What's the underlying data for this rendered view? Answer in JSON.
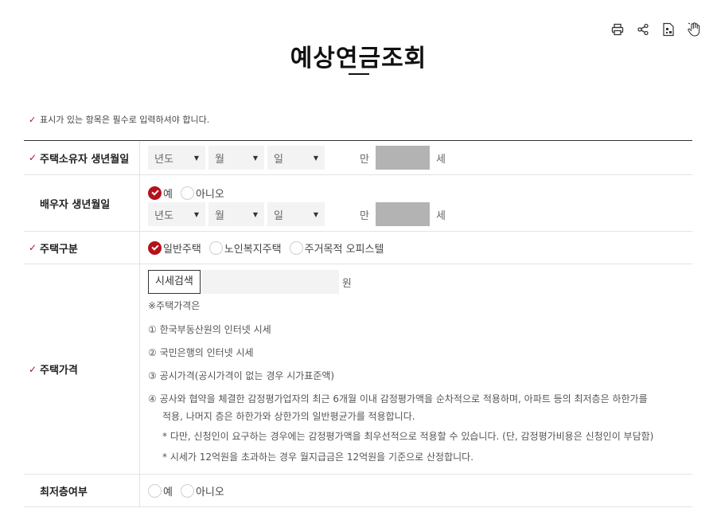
{
  "toolbar": {
    "icons": [
      "print-icon",
      "share-icon",
      "qr-document-icon",
      "hand-touch-icon"
    ]
  },
  "page": {
    "title": "예상연금조회",
    "notice": "표시가 있는 항목은 필수로 입력하셔야 합니다."
  },
  "form": {
    "owner_birth": {
      "label": "주택소유자 생년월일",
      "year": "년도",
      "month": "월",
      "day": "일",
      "age_prefix": "만",
      "age_unit": "세"
    },
    "spouse_birth": {
      "label": "배우자 생년월일",
      "yes": "예",
      "no": "아니오",
      "selected": "예",
      "year": "년도",
      "month": "월",
      "day": "일",
      "age_prefix": "만",
      "age_unit": "세"
    },
    "house_type": {
      "label": "주택구분",
      "options": [
        "일반주택",
        "노인복지주택",
        "주거목적 오피스텔"
      ],
      "selected": "일반주택"
    },
    "house_price": {
      "label": "주택가격",
      "search_button": "시세검색",
      "unit": "원",
      "note_title": "※주택가격은",
      "notes": [
        "① 한국부동산원의 인터넷 시세",
        "② 국민은행의 인터넷 시세",
        "③ 공시가격(공시가격이 없는 경우 시가표준액)",
        "④ 공사와 협약을 체결한 감정평가업자의 최근 6개월 이내 감정평가액을 순차적으로 적용하며, 아파트 등의 최저층은 하한가를"
      ],
      "note4_cont": "적용, 나머지 층은 하한가와 상한가의 일반평균가를 적용합니다.",
      "sub_notes": [
        "* 다만, 신청인이 요구하는 경우에는 감정평가액을 최우선적으로 적용할 수 있습니다. (단, 감정평가비용은 신청인이 부담함)",
        "* 시세가 12억원을 초과하는 경우 월지급금은 12억원을 기준으로 산정합니다."
      ]
    },
    "lowest_floor": {
      "label": "최저층여부",
      "yes": "예",
      "no": "아니오"
    }
  },
  "colors": {
    "accent": "#b5121b",
    "age_box": "#b3b3b3",
    "input_bg": "#f3f3f3"
  }
}
